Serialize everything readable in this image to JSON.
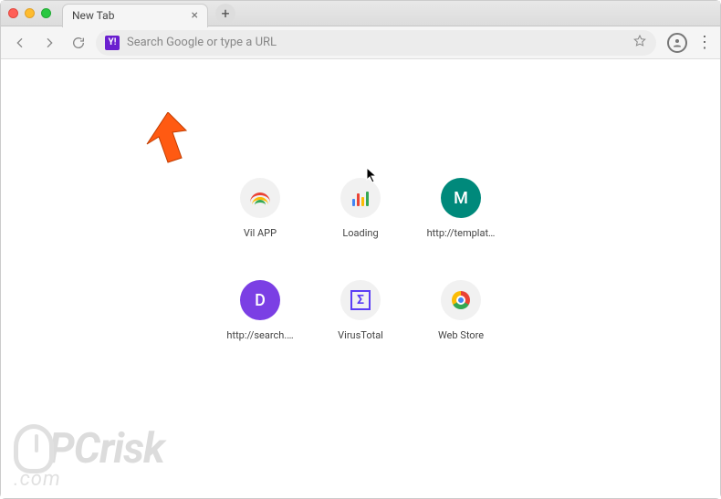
{
  "window": {
    "tab_title": "New Tab"
  },
  "toolbar": {
    "placeholder": "Search Google or type a URL"
  },
  "shortcuts": [
    {
      "label": "Vil APP",
      "kind": "rainbow"
    },
    {
      "label": "Loading",
      "kind": "bars"
    },
    {
      "label": "http://templat…",
      "kind": "letter",
      "letter": "M",
      "bg": "bg-m"
    },
    {
      "label": "http://search.…",
      "kind": "letter",
      "letter": "D",
      "bg": "bg-d"
    },
    {
      "label": "VirusTotal",
      "kind": "sigma"
    },
    {
      "label": "Web Store",
      "kind": "chrome"
    }
  ],
  "watermark": {
    "brand": "PCrisk",
    "domain": ".com"
  }
}
